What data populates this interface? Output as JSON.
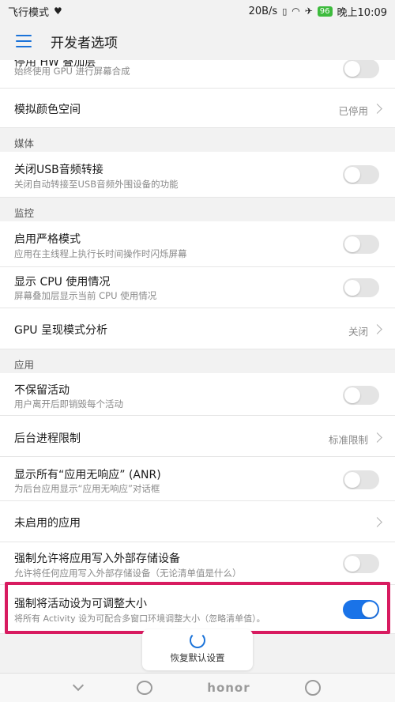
{
  "status": {
    "left_text": "飞行模式",
    "speed": "20B/s",
    "battery": "96",
    "time": "晚上10:09"
  },
  "appbar": {
    "title": "开发者选项"
  },
  "items": {
    "gpu_force": {
      "title": "停用 HW 叠加层",
      "sub": "始终使用 GPU 进行屏幕合成"
    },
    "color_space": {
      "title": "模拟颜色空间",
      "value": "已停用"
    },
    "usb_audio": {
      "title": "关闭USB音频转接",
      "sub": "关闭自动转接至USB音频外围设备的功能"
    },
    "strict_mode": {
      "title": "启用严格模式",
      "sub": "应用在主线程上执行长时间操作时闪烁屏幕"
    },
    "cpu_usage": {
      "title": "显示 CPU 使用情况",
      "sub": "屏幕叠加层显示当前 CPU 使用情况"
    },
    "gpu_profile": {
      "title": "GPU 呈现模式分析",
      "value": "关闭"
    },
    "dont_keep": {
      "title": "不保留活动",
      "sub": "用户离开后即销毁每个活动"
    },
    "bg_limit": {
      "title": "后台进程限制",
      "value": "标准限制"
    },
    "anr": {
      "title": "显示所有“应用无响应” (ANR)",
      "sub": "为后台应用显示“应用无响应”对话框"
    },
    "inactive_apps": {
      "title": "未启用的应用"
    },
    "force_external": {
      "title": "强制允许将应用写入外部存储设备",
      "sub": "允许将任何应用写入外部存储设备（无论清单值是什么）"
    },
    "force_resizable": {
      "title": "强制将活动设为可调整大小",
      "sub": "将所有 Activity 设为可配合多窗口环境调整大小（忽略清单值）。"
    }
  },
  "headers": {
    "media": "媒体",
    "monitor": "监控",
    "apps": "应用"
  },
  "reset": {
    "label": "恢复默认设置"
  },
  "nav": {
    "brand": "honor"
  },
  "toggles": {
    "gpu_force": false,
    "usb_audio": false,
    "strict_mode": false,
    "cpu_usage": false,
    "dont_keep": false,
    "anr": false,
    "force_external": false,
    "force_resizable": true
  },
  "colors": {
    "accent": "#1a73e8",
    "highlight": "#d81b60"
  }
}
